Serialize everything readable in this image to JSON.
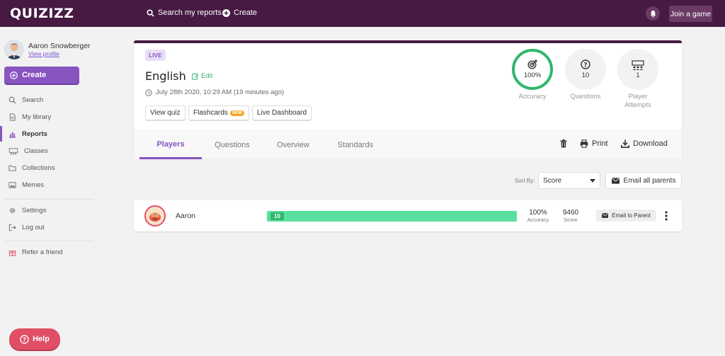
{
  "topbar": {
    "logo": "QUIZIZZ",
    "search_label": "Search my reports",
    "create_label": "Create",
    "join_label": "Join a game"
  },
  "sidebar": {
    "profile_name": "Aaron Snowberger",
    "profile_link": "View profile",
    "create_label": "Create",
    "items": [
      {
        "label": "Search",
        "icon": "search-icon"
      },
      {
        "label": "My library",
        "icon": "library-icon"
      },
      {
        "label": "Reports",
        "icon": "chart-icon",
        "active": true
      },
      {
        "label": "Classes",
        "icon": "classes-icon"
      },
      {
        "label": "Collections",
        "icon": "folder-icon"
      },
      {
        "label": "Memes",
        "icon": "image-icon"
      }
    ],
    "secondary": [
      {
        "label": "Settings",
        "icon": "gear-icon"
      },
      {
        "label": "Log out",
        "icon": "logout-icon"
      }
    ],
    "refer_label": "Refer a friend",
    "help_label": "Help"
  },
  "report": {
    "status": "LIVE",
    "title": "English",
    "edit_label": "Edit",
    "date": "July 28th 2020, 10:29 AM (19 minutes ago)",
    "buttons": {
      "view_quiz": "View quiz",
      "flashcards": "Flashcards",
      "new_tag": "NEW",
      "live_dashboard": "Live Dashboard"
    },
    "stats": {
      "accuracy_value": "100%",
      "accuracy_label": "Accuracy",
      "questions_value": "10",
      "questions_label": "Questions",
      "attempts_value": "1",
      "attempts_label_1": "Player",
      "attempts_label_2": "Attempts"
    },
    "tabs": [
      "Players",
      "Questions",
      "Overview",
      "Standards"
    ],
    "tools": {
      "print": "Print",
      "download": "Download"
    }
  },
  "sort": {
    "label": "Sort By:",
    "value": "Score",
    "email_all": "Email all parents"
  },
  "players": [
    {
      "name": "Aaron",
      "correct": "10",
      "progress_fraction": 1.0,
      "accuracy": "100%",
      "accuracy_label": "Accuracy",
      "score": "9460",
      "score_label": "Score",
      "email_label": "Email to Parent"
    }
  ],
  "colors": {
    "topbar": "#461a42",
    "primary": "#8854c0",
    "success": "#2fb76d",
    "progress": "#59e0a0",
    "help": "#e04f66"
  }
}
